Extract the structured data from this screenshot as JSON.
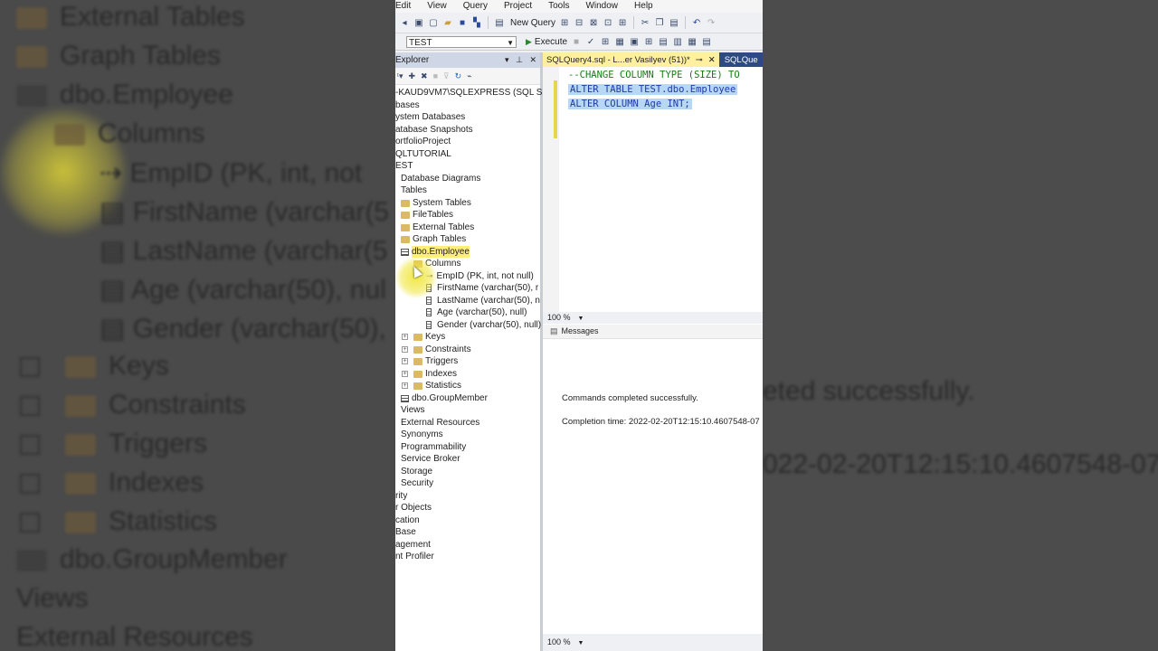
{
  "background_left": {
    "lines": [
      "External Tables",
      "Graph Tables",
      "dbo.Employee",
      "Columns",
      "EmpID (PK, int, not",
      "FirstName (varchar(5",
      "LastName (varchar(5",
      "Age (varchar(50), nul",
      "Gender (varchar(50),",
      "Keys",
      "Constraints",
      "Triggers",
      "Indexes",
      "Statistics",
      "dbo.GroupMember",
      "Views",
      "External Resources"
    ]
  },
  "background_right": {
    "lines": [
      "eted successfully.",
      "022-02-20T12:15:10.4607548-07"
    ]
  },
  "menu": [
    "Edit",
    "View",
    "Query",
    "Project",
    "Tools",
    "Window",
    "Help"
  ],
  "toolbar": {
    "new_query": "New Query",
    "database": "TEST",
    "execute": "Execute"
  },
  "object_explorer": {
    "title": "Explorer",
    "server": "-KAUD9VM7\\SQLEXPRESS (SQL S",
    "nodes": [
      "bases",
      "ystem Databases",
      "atabase Snapshots",
      "ortfolioProject",
      "QLTUTORIAL",
      "EST",
      "Database Diagrams",
      "Tables",
      "System Tables",
      "FileTables",
      "External Tables",
      "Graph Tables",
      "dbo.Employee",
      "Columns",
      "EmpID (PK, int, not null)",
      "FirstName (varchar(50), r",
      "LastName (varchar(50), n",
      "Age (varchar(50), null)",
      "Gender (varchar(50), null)",
      "Keys",
      "Constraints",
      "Triggers",
      "Indexes",
      "Statistics",
      "dbo.GroupMember",
      "Views",
      "External Resources",
      "Synonyms",
      "Programmability",
      "Service Broker",
      "Storage",
      "Security",
      "rity",
      "r Objects",
      "cation",
      "Base",
      "agement",
      "nt Profiler"
    ]
  },
  "editor": {
    "tab_active": "SQLQuery4.sql - L...er Vasilyev (51))*",
    "tab_inactive": "SQLQue",
    "lines": [
      "--CHANGE COLUMN TYPE (SIZE) TO",
      "ALTER TABLE TEST.dbo.Employee",
      "ALTER COLUMN Age INT;"
    ],
    "zoom": "100 %"
  },
  "messages": {
    "tab": "Messages",
    "line1": "Commands completed successfully.",
    "line2": "Completion time: 2022-02-20T12:15:10.4607548-07",
    "zoom": "100 %"
  }
}
